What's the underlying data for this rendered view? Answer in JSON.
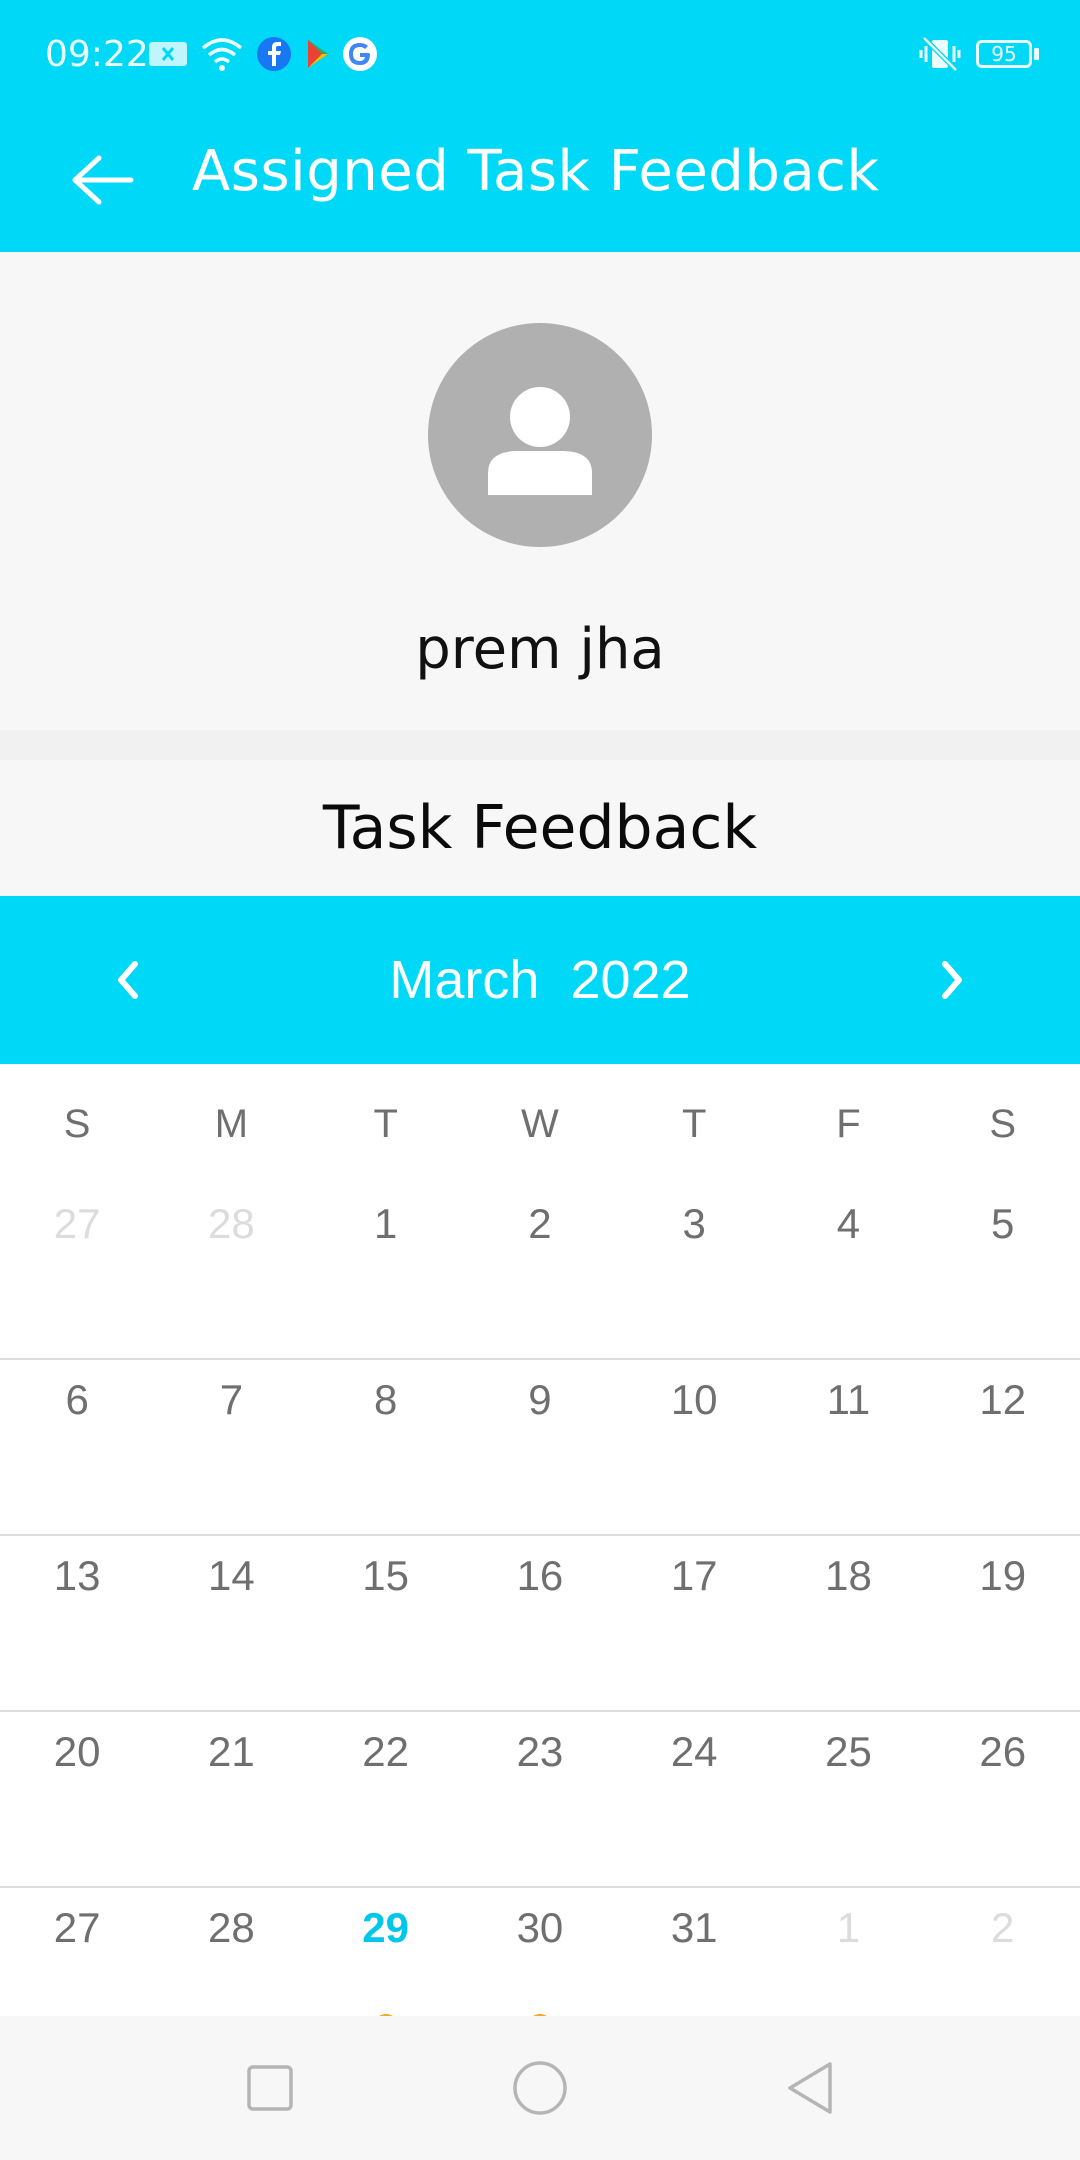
{
  "status_bar": {
    "time": "09:22",
    "battery": "95",
    "icons": [
      "notification-x-icon",
      "wifi-icon",
      "facebook-icon",
      "play-store-icon",
      "google-icon",
      "vibrate-icon",
      "battery-icon"
    ]
  },
  "app_bar": {
    "title": "Assigned Task Feedback",
    "back_icon": "arrow-left-icon"
  },
  "profile": {
    "name": "prem jha",
    "avatar_icon": "person-icon"
  },
  "section": {
    "title": "Task Feedback"
  },
  "calendar": {
    "month": "March",
    "year": "2022",
    "prev_icon": "chevron-left-icon",
    "next_icon": "chevron-right-icon",
    "weekdays": [
      "S",
      "M",
      "T",
      "W",
      "T",
      "F",
      "S"
    ],
    "weeks": [
      [
        "27",
        "28",
        "1",
        "2",
        "3",
        "4",
        "5"
      ],
      [
        "6",
        "7",
        "8",
        "9",
        "10",
        "11",
        "12"
      ],
      [
        "13",
        "14",
        "15",
        "16",
        "17",
        "18",
        "19"
      ],
      [
        "20",
        "21",
        "22",
        "23",
        "24",
        "25",
        "26"
      ],
      [
        "27",
        "28",
        "29",
        "30",
        "31",
        "1",
        "2"
      ]
    ],
    "highlighted_day": "29",
    "days_with_feedback": [
      "29",
      "30"
    ]
  },
  "colors": {
    "primary": "#00d8f7",
    "today": "#00c7ea",
    "event_dot": "#f5a623",
    "muted_day": "#dcdcdc",
    "day_text": "#6f6f6f"
  },
  "nav_bar": {
    "buttons": [
      "recent-apps-icon",
      "home-icon",
      "back-triangle-icon"
    ]
  }
}
